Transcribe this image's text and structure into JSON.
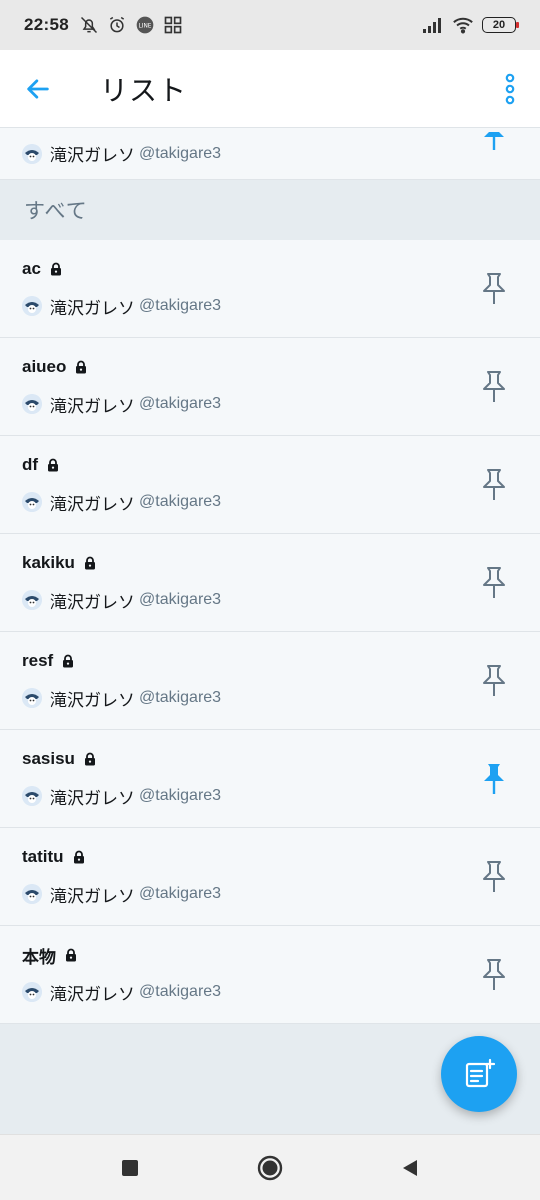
{
  "status_bar": {
    "time": "22:58",
    "left_icons": [
      "bell-off-icon",
      "alarm-icon",
      "line-app-icon",
      "apps-grid-icon"
    ],
    "right_icons": [
      "signal-icon",
      "wifi-icon"
    ],
    "battery_level": "20"
  },
  "app_bar": {
    "title": "リスト",
    "back_icon": "arrow-left-icon",
    "more_icon": "more-vertical-icon",
    "accent_color": "#1da1f2"
  },
  "pinned_partial": {
    "owner_name": "滝沢ガレソ",
    "owner_handle": "@takigare3",
    "pinned": true
  },
  "section": {
    "title": "すべて"
  },
  "lists": [
    {
      "name": "ac",
      "private": true,
      "owner_name": "滝沢ガレソ",
      "owner_handle": "@takigare3",
      "pinned": false
    },
    {
      "name": "aiueo",
      "private": true,
      "owner_name": "滝沢ガレソ",
      "owner_handle": "@takigare3",
      "pinned": false
    },
    {
      "name": "df",
      "private": true,
      "owner_name": "滝沢ガレソ",
      "owner_handle": "@takigare3",
      "pinned": false
    },
    {
      "name": "kakiku",
      "private": true,
      "owner_name": "滝沢ガレソ",
      "owner_handle": "@takigare3",
      "pinned": false
    },
    {
      "name": "resf",
      "private": true,
      "owner_name": "滝沢ガレソ",
      "owner_handle": "@takigare3",
      "pinned": false
    },
    {
      "name": "sasisu",
      "private": true,
      "owner_name": "滝沢ガレソ",
      "owner_handle": "@takigare3",
      "pinned": true
    },
    {
      "name": "tatitu",
      "private": true,
      "owner_name": "滝沢ガレソ",
      "owner_handle": "@takigare3",
      "pinned": false
    },
    {
      "name": "本物",
      "private": true,
      "owner_name": "滝沢ガレソ",
      "owner_handle": "@takigare3",
      "pinned": false
    }
  ],
  "fab": {
    "icon": "new-list-icon"
  },
  "nav_bar": {
    "icons": [
      "recents-square-icon",
      "home-circle-icon",
      "back-triangle-icon"
    ]
  },
  "colors": {
    "pin_active": "#1da1f2",
    "pin_inactive": "#657786",
    "background": "#e6ecf0"
  }
}
